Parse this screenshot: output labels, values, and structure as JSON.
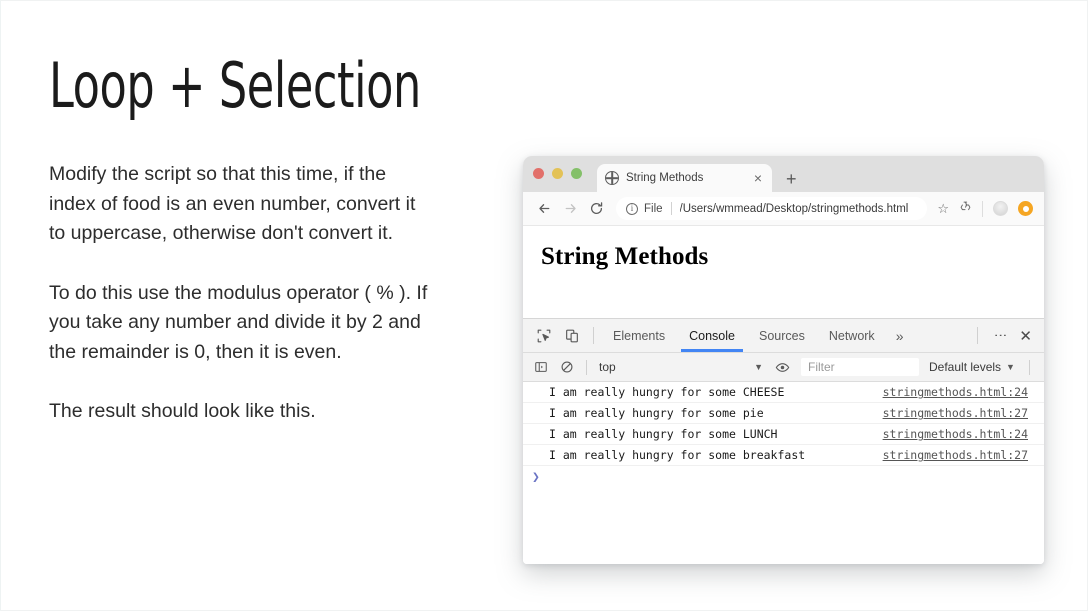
{
  "slide": {
    "title": "Loop + Selection",
    "paragraphs": [
      "Modify the script so that this time, if the index of food is an even number, convert it to uppercase, otherwise don't convert it.",
      "To do this use the modulus operator ( % ). If you take any number and divide it by 2 and the remainder is 0, then it is even.",
      "The result should look like this."
    ]
  },
  "browser": {
    "window_controls": {
      "close_label": "close",
      "minimize_label": "minimize",
      "maximize_label": "maximize"
    },
    "tab": {
      "title": "String Methods",
      "favicon": "globe-icon",
      "close_label": "×"
    },
    "new_tab_label": "+",
    "toolbar": {
      "back_label": "←",
      "forward_label": "→",
      "reload_label": "↻",
      "security_chip": "File",
      "url": "/Users/wmmead/Desktop/stringmethods.html",
      "bookmark_icon": "star-icon",
      "extensions_icon": "sync-icon",
      "avatar_icon": "avatar-circle",
      "profile_icon": "profile-circle"
    },
    "page": {
      "heading": "String Methods"
    }
  },
  "devtools": {
    "inspect_icon": "inspect-cursor-icon",
    "device_icon": "device-toolbar-icon",
    "tabs": [
      {
        "label": "Elements",
        "active": false
      },
      {
        "label": "Console",
        "active": true
      },
      {
        "label": "Sources",
        "active": false
      },
      {
        "label": "Network",
        "active": false
      }
    ],
    "more_tabs_label": "»",
    "kebab_label": "⋮",
    "close_label": "✕",
    "console_toolbar": {
      "sidebar_icon": "console-sidebar-icon",
      "clear_icon": "clear-console-icon",
      "context": "top",
      "context_caret": "▼",
      "eye_icon": "live-expression-icon",
      "filter_placeholder": "Filter",
      "levels": "Default levels",
      "levels_caret": "▼",
      "settings_icon": "gear-icon"
    },
    "console_logs": [
      {
        "message": "I am really hungry for some CHEESE",
        "source": "stringmethods.html:24"
      },
      {
        "message": "I am really hungry for some pie",
        "source": "stringmethods.html:27"
      },
      {
        "message": "I am really hungry for some LUNCH",
        "source": "stringmethods.html:24"
      },
      {
        "message": "I am really hungry for some breakfast",
        "source": "stringmethods.html:27"
      }
    ],
    "prompt_symbol": "❯"
  },
  "colors": {
    "accent_blue": "#4285f4",
    "prompt_purple": "#6b74c4",
    "profile_orange": "#f5a623",
    "traffic_red": "#e2706a",
    "traffic_yellow": "#e3c257",
    "traffic_green": "#84c069"
  }
}
